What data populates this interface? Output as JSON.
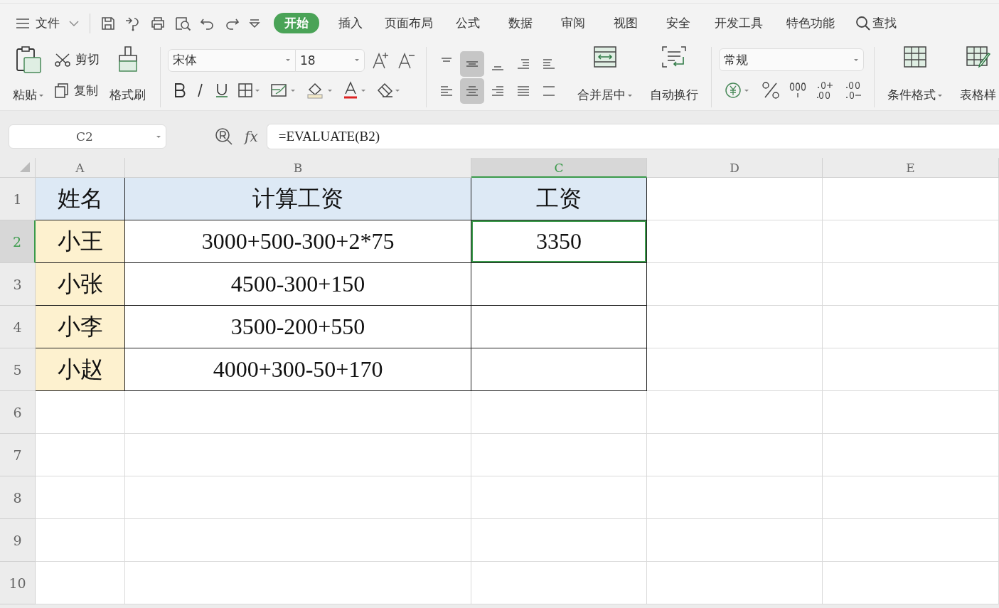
{
  "menu": {
    "file_label": "文件",
    "tabs": [
      {
        "label": "开始",
        "selected": true
      },
      {
        "label": "插入",
        "selected": false
      },
      {
        "label": "页面布局",
        "selected": false
      },
      {
        "label": "公式",
        "selected": false
      },
      {
        "label": "数据",
        "selected": false
      },
      {
        "label": "审阅",
        "selected": false
      },
      {
        "label": "视图",
        "selected": false
      },
      {
        "label": "安全",
        "selected": false
      },
      {
        "label": "开发工具",
        "selected": false
      },
      {
        "label": "特色功能",
        "selected": false
      }
    ],
    "search_label": "查找"
  },
  "ribbon": {
    "paste_label": "粘贴",
    "cut_label": "剪切",
    "copy_label": "复制",
    "painter_label": "格式刷",
    "font_name": "宋体",
    "font_size": "18",
    "align_buttons": [
      {
        "kind": "top",
        "selected": false
      },
      {
        "kind": "middle",
        "selected": true
      },
      {
        "kind": "bottom",
        "selected": false
      },
      {
        "kind": "outdent",
        "selected": false
      },
      {
        "kind": "indent",
        "selected": false
      },
      {
        "kind": "left",
        "selected": false
      },
      {
        "kind": "center",
        "selected": true
      },
      {
        "kind": "right",
        "selected": false
      },
      {
        "kind": "justify",
        "selected": false
      },
      {
        "kind": "distributed",
        "selected": false
      }
    ],
    "merge_label": "合并居中",
    "wrap_label": "自动换行",
    "number_format": "常规",
    "conditional_label": "条件格式",
    "table_style_label": "表格样"
  },
  "formula_bar": {
    "name_box": "C2",
    "fx_label": "fx",
    "formula": "=EVALUATE(B2)"
  },
  "sheet": {
    "columns": [
      {
        "label": "A",
        "selected": false
      },
      {
        "label": "B",
        "selected": false
      },
      {
        "label": "C",
        "selected": true
      },
      {
        "label": "D",
        "selected": false
      },
      {
        "label": "E",
        "selected": false
      }
    ],
    "rows": [
      {
        "label": "1",
        "selected": false,
        "cells": [
          {
            "text": "姓名",
            "kind": "header",
            "selected": false
          },
          {
            "text": "计算工资",
            "kind": "header",
            "selected": false
          },
          {
            "text": "工资",
            "kind": "header",
            "selected": false
          }
        ]
      },
      {
        "label": "2",
        "selected": true,
        "cells": [
          {
            "text": "小王",
            "kind": "name",
            "selected": false
          },
          {
            "text": "3000+500-300+2*75",
            "kind": "plain",
            "selected": false
          },
          {
            "text": "3350",
            "kind": "plain",
            "selected": true
          }
        ]
      },
      {
        "label": "3",
        "selected": false,
        "cells": [
          {
            "text": "小张",
            "kind": "name",
            "selected": false
          },
          {
            "text": "4500-300+150",
            "kind": "plain",
            "selected": false
          },
          {
            "text": "",
            "kind": "plain",
            "selected": false
          }
        ]
      },
      {
        "label": "4",
        "selected": false,
        "cells": [
          {
            "text": "小李",
            "kind": "name",
            "selected": false
          },
          {
            "text": "3500-200+550",
            "kind": "plain",
            "selected": false
          },
          {
            "text": "",
            "kind": "plain",
            "selected": false
          }
        ]
      },
      {
        "label": "5",
        "selected": false,
        "cells": [
          {
            "text": "小赵",
            "kind": "name",
            "selected": false
          },
          {
            "text": "4000+300-50+170",
            "kind": "plain",
            "selected": false
          },
          {
            "text": "",
            "kind": "plain",
            "selected": false
          }
        ]
      },
      {
        "label": "6",
        "selected": false,
        "cells": []
      },
      {
        "label": "7",
        "selected": false,
        "cells": []
      },
      {
        "label": "8",
        "selected": false,
        "cells": []
      },
      {
        "label": "9",
        "selected": false,
        "cells": []
      },
      {
        "label": "10",
        "selected": false,
        "cells": []
      }
    ]
  }
}
